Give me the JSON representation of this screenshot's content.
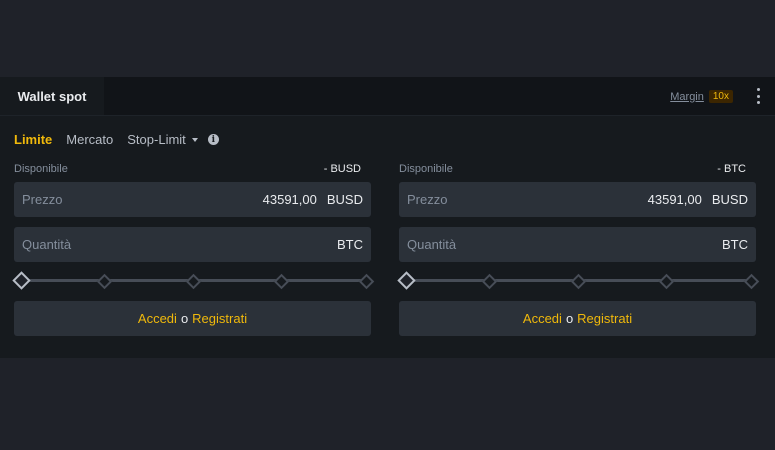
{
  "tabs": {
    "active": "Wallet spot"
  },
  "margin": {
    "label": "Margin",
    "leverage": "10x"
  },
  "order_types": {
    "limit": "Limite",
    "market": "Mercato",
    "stop_limit": "Stop-Limit"
  },
  "buy": {
    "available_label": "Disponibile",
    "available_value": "- BUSD",
    "price_label": "Prezzo",
    "price_value": "43591,00",
    "price_unit": "BUSD",
    "qty_label": "Quantità",
    "qty_unit": "BTC",
    "slider_percent": 0,
    "login": {
      "login_text": "Accedi",
      "or": "o",
      "register_text": "Registrati"
    }
  },
  "sell": {
    "available_label": "Disponibile",
    "available_value": "- BTC",
    "price_label": "Prezzo",
    "price_value": "43591,00",
    "price_unit": "BUSD",
    "qty_label": "Quantità",
    "qty_unit": "BTC",
    "slider_percent": 0,
    "login": {
      "login_text": "Accedi",
      "or": "o",
      "register_text": "Registrati"
    }
  },
  "colors": {
    "accent": "#f0b90b",
    "background": "#1f2229",
    "panel": "#161a1e",
    "field": "#2b3139"
  },
  "icons": [
    "more-vertical-icon",
    "caret-down-icon",
    "info-icon"
  ]
}
